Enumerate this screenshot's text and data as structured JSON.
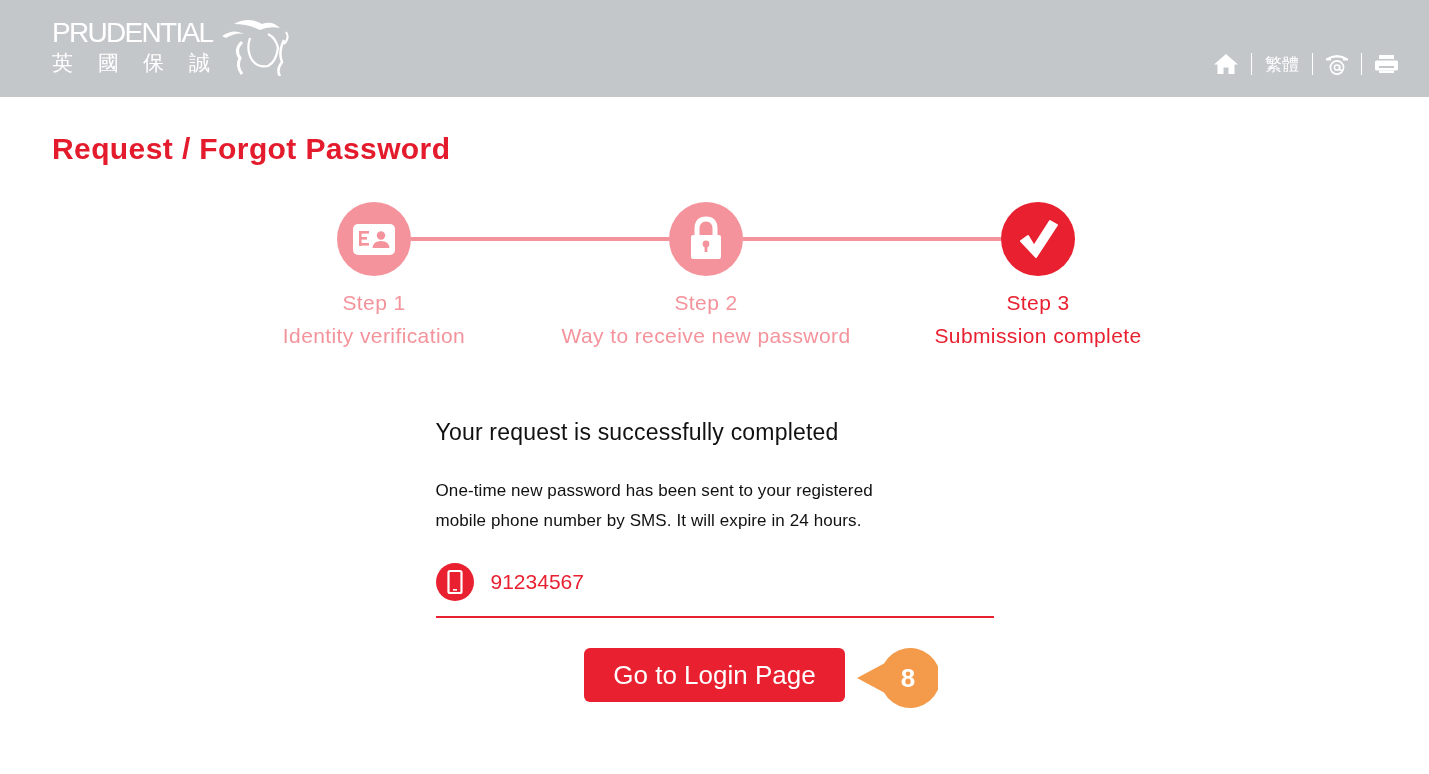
{
  "header": {
    "logo": {
      "wordmark": "PRUDENTIAL",
      "chinese_name": "英 國 保 誠"
    },
    "nav": [
      {
        "kind": "home"
      },
      {
        "kind": "language",
        "label": "繁體"
      },
      {
        "kind": "contact"
      },
      {
        "kind": "print"
      }
    ]
  },
  "page_title": "Request / Forgot Password",
  "steps": [
    {
      "kind": "identity",
      "step": "Step 1",
      "title": "Identity verification",
      "current": false
    },
    {
      "kind": "password",
      "step": "Step 2",
      "title": "Way to receive new password",
      "current": false
    },
    {
      "kind": "complete",
      "step": "Step 3",
      "title": "Submission complete",
      "current": true
    }
  ],
  "result": {
    "heading": "Your request is successfully completed",
    "message": "One-time new password has been sent to your registered mobile phone number by SMS. It will expire in 24 hours.",
    "phone": "91234567",
    "button": "Go to Login Page",
    "callout": "8"
  }
}
